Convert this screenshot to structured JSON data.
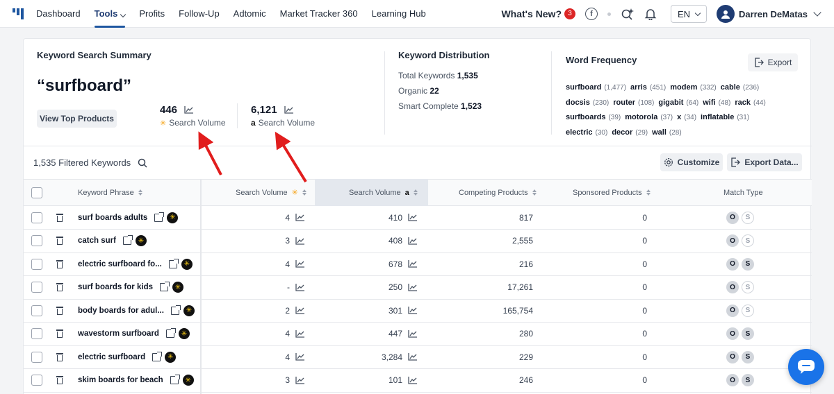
{
  "nav": {
    "items": [
      "Dashboard",
      "Tools",
      "Profits",
      "Follow-Up",
      "Adtomic",
      "Market Tracker 360",
      "Learning Hub"
    ],
    "active_index": 1,
    "whats_new": "What's New?",
    "whats_new_count": "3",
    "language": "EN",
    "user_name": "Darren DeMatas"
  },
  "summary": {
    "title": "Keyword Search Summary",
    "query": "“surfboard”",
    "view_top_products": "View Top Products",
    "walmart_volume": "446",
    "amazon_volume": "6,121",
    "volume_label": "Search Volume"
  },
  "distribution": {
    "title": "Keyword Distribution",
    "lines": [
      {
        "label": "Total Keywords",
        "value": "1,535"
      },
      {
        "label": "Organic",
        "value": "22"
      },
      {
        "label": "Smart Complete",
        "value": "1,523"
      }
    ]
  },
  "word_frequency": {
    "title": "Word Frequency",
    "export": "Export",
    "words": [
      {
        "w": "surfboard",
        "c": "(1,477)"
      },
      {
        "w": "arris",
        "c": "(451)"
      },
      {
        "w": "modem",
        "c": "(332)"
      },
      {
        "w": "cable",
        "c": "(236)"
      },
      {
        "w": "docsis",
        "c": "(230)"
      },
      {
        "w": "router",
        "c": "(108)"
      },
      {
        "w": "gigabit",
        "c": "(64)"
      },
      {
        "w": "wifi",
        "c": "(48)"
      },
      {
        "w": "rack",
        "c": "(44)"
      },
      {
        "w": "surfboards",
        "c": "(39)"
      },
      {
        "w": "motorola",
        "c": "(37)"
      },
      {
        "w": "x",
        "c": "(34)"
      },
      {
        "w": "inflatable",
        "c": "(31)"
      },
      {
        "w": "electric",
        "c": "(30)"
      },
      {
        "w": "decor",
        "c": "(29)"
      },
      {
        "w": "wall",
        "c": "(28)"
      }
    ]
  },
  "toolbar": {
    "filtered": "1,535 Filtered Keywords",
    "customize": "Customize",
    "export_data": "Export Data..."
  },
  "table": {
    "headers": {
      "keyword": "Keyword Phrase",
      "sv_walmart": "Search Volume",
      "sv_amazon": "Search Volume",
      "competing": "Competing Products",
      "sponsored": "Sponsored Products",
      "match": "Match Type"
    },
    "match_o": "O",
    "match_s": "S",
    "rows": [
      {
        "keyword": "surf boards adults",
        "sv_w": "4",
        "sv_a": "410",
        "competing": "817",
        "sponsored": "0",
        "s_active": false
      },
      {
        "keyword": "catch surf",
        "sv_w": "3",
        "sv_a": "408",
        "competing": "2,555",
        "sponsored": "0",
        "s_active": false
      },
      {
        "keyword": "electric surfboard fo...",
        "sv_w": "4",
        "sv_a": "678",
        "competing": "216",
        "sponsored": "0",
        "s_active": true
      },
      {
        "keyword": "surf boards for kids",
        "sv_w": "-",
        "sv_a": "250",
        "competing": "17,261",
        "sponsored": "0",
        "s_active": false
      },
      {
        "keyword": "body boards for adul...",
        "sv_w": "2",
        "sv_a": "301",
        "competing": "165,754",
        "sponsored": "0",
        "s_active": false
      },
      {
        "keyword": "wavestorm surfboard",
        "sv_w": "4",
        "sv_a": "447",
        "competing": "280",
        "sponsored": "0",
        "s_active": true
      },
      {
        "keyword": "electric surfboard",
        "sv_w": "4",
        "sv_a": "3,284",
        "competing": "229",
        "sponsored": "0",
        "s_active": true
      },
      {
        "keyword": "skim boards for beach",
        "sv_w": "3",
        "sv_a": "101",
        "competing": "246",
        "sponsored": "0",
        "s_active": true
      }
    ]
  },
  "colors": {
    "brand": "#1e56a0",
    "annotation_arrow": "#e11d1d",
    "chat_button": "#1a73e8"
  }
}
